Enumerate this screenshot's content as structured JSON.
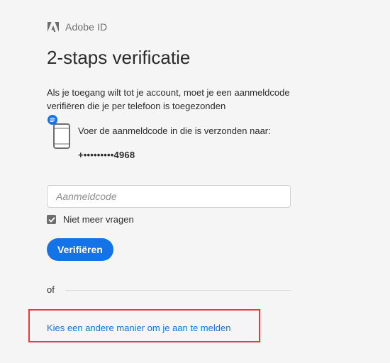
{
  "brand": {
    "name": "Adobe ID",
    "logo_icon": "adobe-logo-icon",
    "logo_color": "#6e6e6e"
  },
  "page": {
    "title": "2-staps verificatie",
    "description": "Als je toegang wilt tot je account, moet je een aanmeldcode verifiëren die je per telefoon is toegezonden"
  },
  "device": {
    "icon": "phone-icon",
    "badge_icon": "message-badge-icon",
    "badge_color": "#1473e6",
    "instruction": "Voer de aanmeldcode in die is verzonden naar:",
    "masked_number": "+•••••••••4968"
  },
  "code_field": {
    "value": "",
    "placeholder": "Aanmeldcode"
  },
  "remember": {
    "label": "Niet meer vragen",
    "checked": true
  },
  "actions": {
    "verify_label": "Verifiëren",
    "verify_color": "#1473e6"
  },
  "alternative": {
    "or_label": "of",
    "link_label": "Kies een andere manier om je aan te melden",
    "link_color": "#1473e6",
    "highlight_color": "#e33d3d"
  }
}
